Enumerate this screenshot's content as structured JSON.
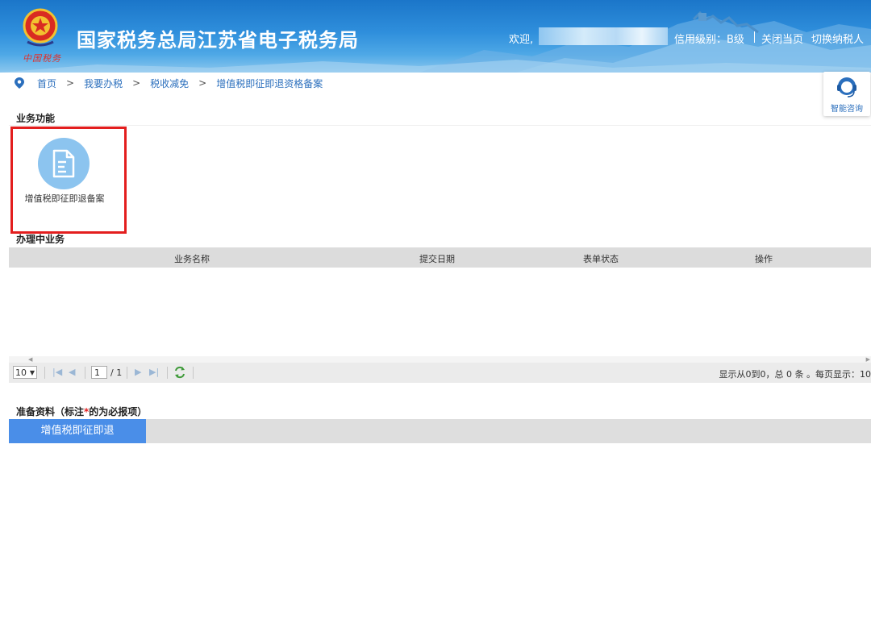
{
  "header": {
    "title": "国家税务总局江苏省电子税务局",
    "emblem_text": "中国税务",
    "welcome": "欢迎,",
    "credit_level": "信用级别：B级",
    "close_page": "关闭当页",
    "switch_taxpayer": "切换纳税人",
    "colors": {
      "header_blue": "#1b76c9",
      "title_white": "#ffffff"
    }
  },
  "breadcrumb": {
    "items": [
      "首页",
      "我要办税",
      "税收减免",
      "增值税即征即退资格备案"
    ],
    "separator": ">"
  },
  "consult": {
    "label": "智能咨询",
    "icon": "headset-icon"
  },
  "business_functions": {
    "title": "业务功能",
    "items": [
      {
        "label": "增值税即征即退备案",
        "icon": "document-icon"
      }
    ]
  },
  "in_progress": {
    "title": "办理中业务",
    "columns": [
      "业务名称",
      "提交日期",
      "表单状态",
      "操作"
    ],
    "rows": []
  },
  "pager": {
    "page_size": "10",
    "current_page": "1",
    "total_pages": "/ 1",
    "summary": "显示从0到0，总 0 条 。每页显示：10"
  },
  "materials": {
    "title_prefix": "准备资料（标注",
    "required_mark": "*",
    "title_suffix": "的为必报项）",
    "tabs": [
      "增值税即征即退"
    ],
    "colors": {
      "active_tab": "#4a8ee8",
      "required": "#e31e1e"
    }
  },
  "highlight": {
    "color": "#e31e1e"
  }
}
